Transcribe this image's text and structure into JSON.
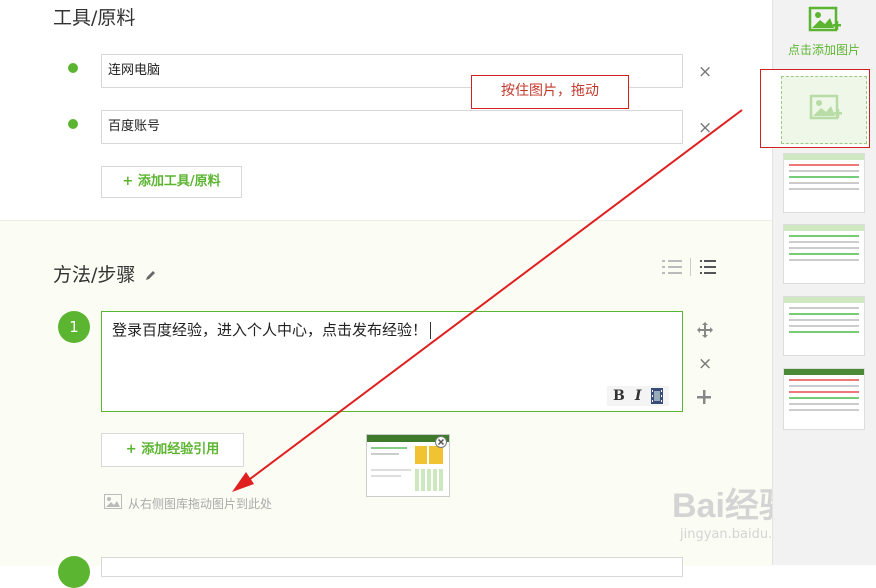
{
  "tools": {
    "title": "工具/原料",
    "items": [
      {
        "label": "连网电脑"
      },
      {
        "label": "百度账号"
      }
    ],
    "add_button": "+ 添加工具/原料",
    "remove_glyph": "×"
  },
  "steps": {
    "title": "方法/步骤",
    "items": [
      {
        "number": "1",
        "text": "登录百度经验，进入个人中心，点击发布经验！"
      }
    ],
    "format_bold": "B",
    "format_italic": "I",
    "add_reference_button": "+ 添加经验引用",
    "drag_hint": "从右侧图库拖动图片到此处"
  },
  "annotation": {
    "callout_text": "按住图片，拖动"
  },
  "sidebar": {
    "add_image_label": "点击添加图片"
  },
  "watermark": {
    "brand": "Bai经验",
    "url": "jingyan.baidu.com"
  },
  "colors": {
    "accent_green": "#5cb531",
    "annotation_red": "#d02020"
  }
}
